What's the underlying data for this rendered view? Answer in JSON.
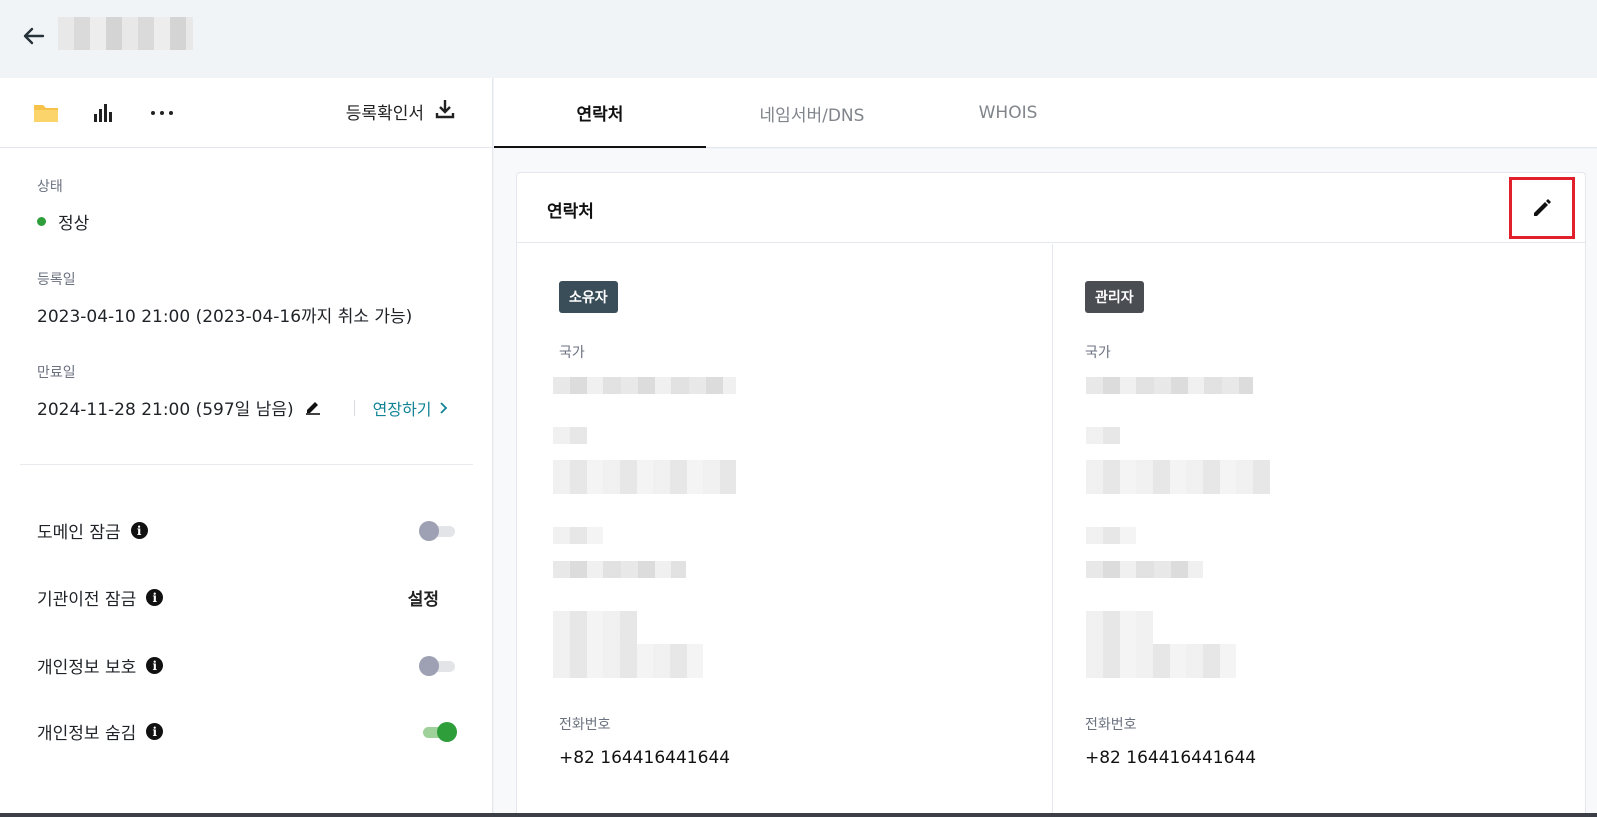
{
  "left_toolbar": {
    "certificate_label": "등록확인서"
  },
  "status": {
    "label": "상태",
    "value": "정상",
    "color": "#2e9e3a"
  },
  "registered": {
    "label": "등록일",
    "value": "2023-04-10 21:00 (2023-04-16까지 취소 가능)"
  },
  "expires": {
    "label": "만료일",
    "value": "2024-11-28 21:00 (597일 남음)",
    "renew_label": "연장하기"
  },
  "settings": [
    {
      "label": "도메인 잠금",
      "state": "off"
    },
    {
      "label": "기관이전 잠금",
      "action_label": "설정"
    },
    {
      "label": "개인정보 보호",
      "state": "off"
    },
    {
      "label": "개인정보 숨김",
      "state": "on"
    }
  ],
  "tabs": [
    {
      "label": "연락처",
      "active": true
    },
    {
      "label": "네임서버/DNS",
      "active": false
    },
    {
      "label": "WHOIS",
      "active": false
    }
  ],
  "card": {
    "title": "연락처",
    "columns": [
      {
        "badge": "소유자",
        "badge_color": "#3a4e5a",
        "country_label": "국가",
        "phone_label": "전화번호",
        "phone_value": "+82 164416441644"
      },
      {
        "badge": "관리자",
        "badge_color": "#4a4d52",
        "country_label": "국가",
        "phone_label": "전화번호",
        "phone_value": "+82 164416441644"
      }
    ]
  },
  "icons": [
    "back-arrow-icon",
    "folder-icon",
    "bar-chart-icon",
    "more-horizontal-icon",
    "download-icon",
    "pencil-icon",
    "info-icon",
    "chevron-right-icon"
  ]
}
